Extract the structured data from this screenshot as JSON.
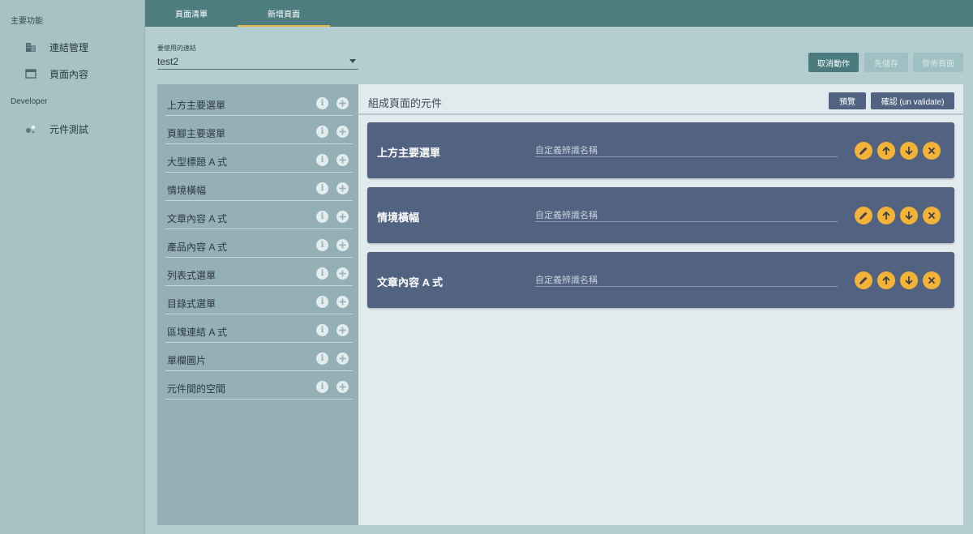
{
  "sidebar": {
    "section_main": "主要功能",
    "section_dev": "Developer",
    "items": [
      {
        "label": "連結管理",
        "icon": "building-icon"
      },
      {
        "label": "頁面內容",
        "icon": "browser-window-icon"
      },
      {
        "label": "元件測試",
        "icon": "bubbles-icon"
      }
    ]
  },
  "tabs": [
    {
      "label": "頁面清單"
    },
    {
      "label": "新增頁面",
      "active": true
    }
  ],
  "connection_select": {
    "label": "要使用的連結",
    "value": "test2"
  },
  "actions": {
    "cancel": "取消動作",
    "save": "先儲存",
    "publish": "發佈頁面"
  },
  "component_list": [
    {
      "label": "上方主要選單"
    },
    {
      "label": "頁腳主要選單"
    },
    {
      "label": "大型標題 A 式"
    },
    {
      "label": "情境橫幅"
    },
    {
      "label": "文章內容 A 式"
    },
    {
      "label": "產品內容 A 式"
    },
    {
      "label": "列表式選單"
    },
    {
      "label": "目錄式選單"
    },
    {
      "label": "區塊連結 A 式"
    },
    {
      "label": "單欄圖片"
    },
    {
      "label": "元件間的空間"
    }
  ],
  "info_glyph": "i",
  "compose": {
    "title": "組成頁面的元件",
    "preview": "預覽",
    "confirm": "確認 (un validate)",
    "name_placeholder": "自定義辨識名稱",
    "cards": [
      {
        "title": "上方主要選單"
      },
      {
        "title": "情境橫幅"
      },
      {
        "title": "文章內容 A 式"
      }
    ]
  },
  "colors": {
    "topbar": "#4e7d80",
    "active_tab_underline": "#e9b543",
    "card_bg": "#526382",
    "card_button": "#f2b338"
  }
}
